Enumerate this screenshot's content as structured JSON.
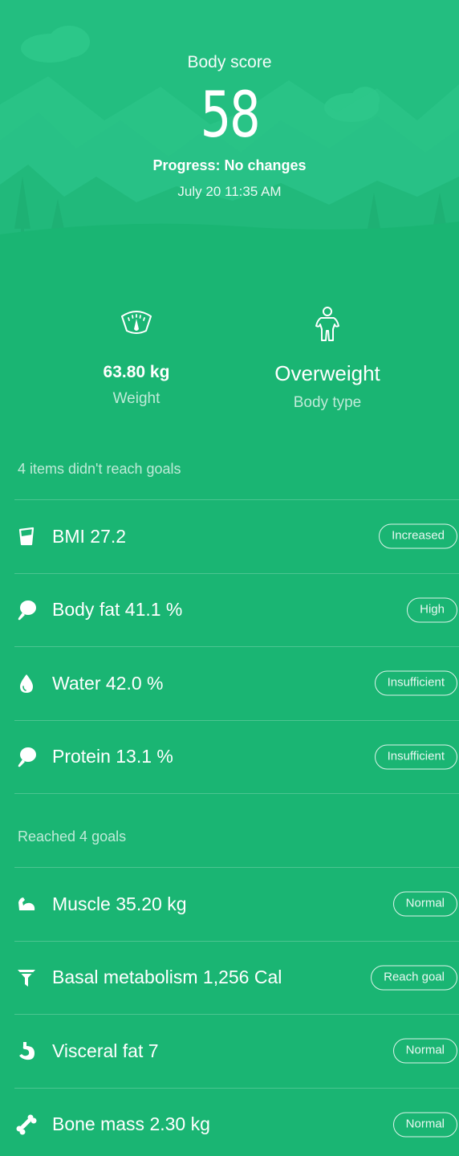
{
  "header": {
    "score_label": "Body score",
    "score": "58",
    "progress": "Progress: No changes",
    "timestamp": "July 20 11:35 AM"
  },
  "stats": {
    "weight": {
      "value": "63.80 kg",
      "label": "Weight",
      "icon": "scale-icon"
    },
    "body_type": {
      "value": "Overweight",
      "label": "Body type",
      "icon": "person-icon"
    }
  },
  "unmet": {
    "title": "4 items didn't reach goals",
    "items": [
      {
        "label": "BMI 27.2",
        "status": "Increased",
        "icon": "bmi-cup-icon"
      },
      {
        "label": "Body fat 41.1 %",
        "status": "High",
        "icon": "drumstick-icon"
      },
      {
        "label": "Water 42.0 %",
        "status": "Insufficient",
        "icon": "water-drop-icon"
      },
      {
        "label": "Protein 13.1 %",
        "status": "Insufficient",
        "icon": "drumstick-icon"
      }
    ]
  },
  "met": {
    "title": "Reached 4 goals",
    "items": [
      {
        "label": "Muscle 35.20 kg",
        "status": "Normal",
        "icon": "muscle-icon"
      },
      {
        "label": "Basal metabolism 1,256 Cal",
        "status": "Reach goal",
        "icon": "funnel-icon"
      },
      {
        "label": "Visceral fat 7",
        "status": "Normal",
        "icon": "stomach-icon"
      },
      {
        "label": "Bone mass 2.30 kg",
        "status": "Normal",
        "icon": "bone-icon"
      }
    ]
  },
  "colors": {
    "background": "#1ab573",
    "hero_top": "#26c183"
  }
}
